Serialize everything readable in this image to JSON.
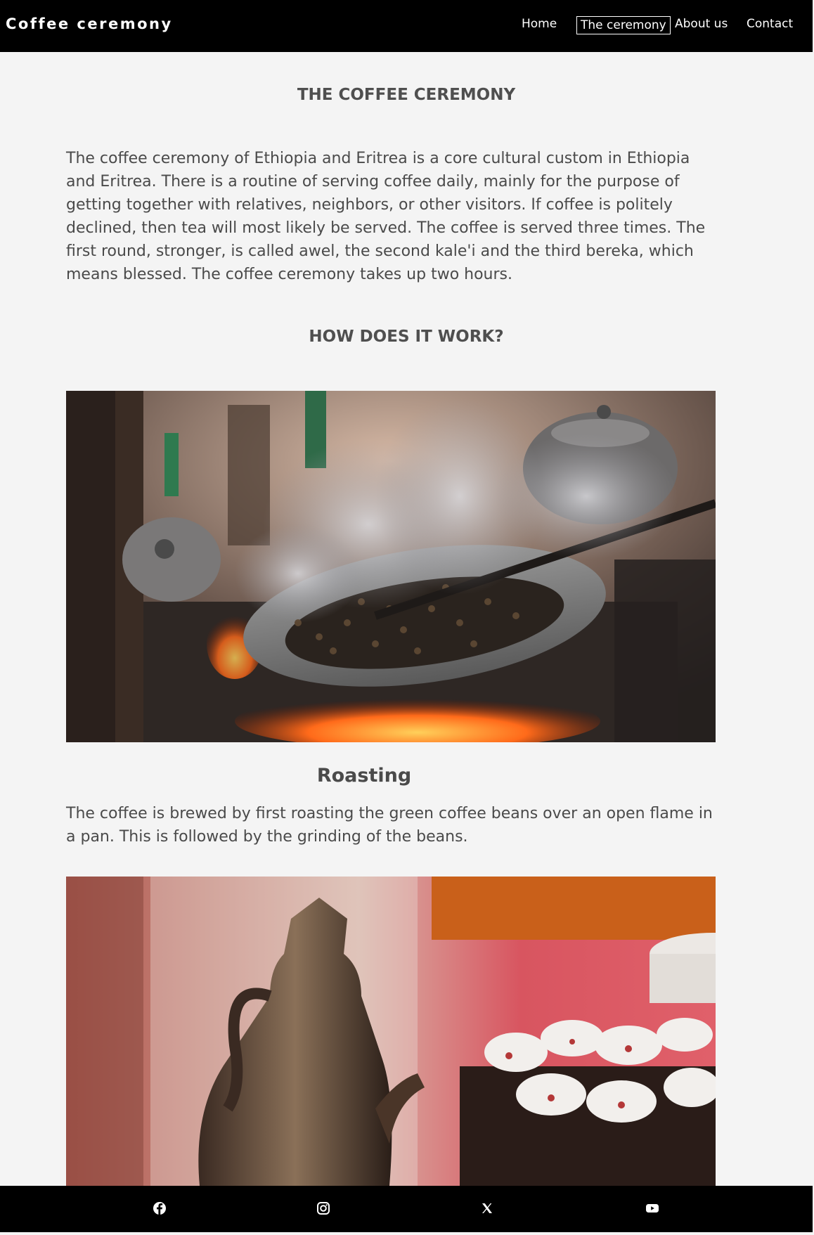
{
  "nav": {
    "brand": "Coffee ceremony",
    "links": [
      "Home",
      "The ceremony",
      "About us",
      "Contact"
    ]
  },
  "main": {
    "title": "THE COFFEE CEREMONY",
    "intro": "The coffee ceremony of Ethiopia and Eritrea is a core cultural custom in Ethiopia and Eritrea. There is a routine of serving coffee daily, mainly for the purpose of getting together with relatives, neighbors, or other visitors. If coffee is politely declined, then tea will most likely be served. The coffee is served three times. The first round, stronger, is called awel, the second kale'i and the third bereka, which means blessed. The coffee ceremony takes up two hours.",
    "how_title": "HOW DOES IT WORK?",
    "steps": [
      {
        "title": "Roasting",
        "text": "The coffee is brewed by first roasting the green coffee beans over an open flame in a pan. This is followed by the grinding of the beans."
      }
    ]
  },
  "footer": {
    "icons": [
      "facebook-icon",
      "instagram-icon",
      "x-icon",
      "youtube-icon"
    ]
  },
  "colors": {
    "nav_bg": "#000000",
    "page_bg": "#f4f4f4",
    "text": "#4a4a4a"
  }
}
